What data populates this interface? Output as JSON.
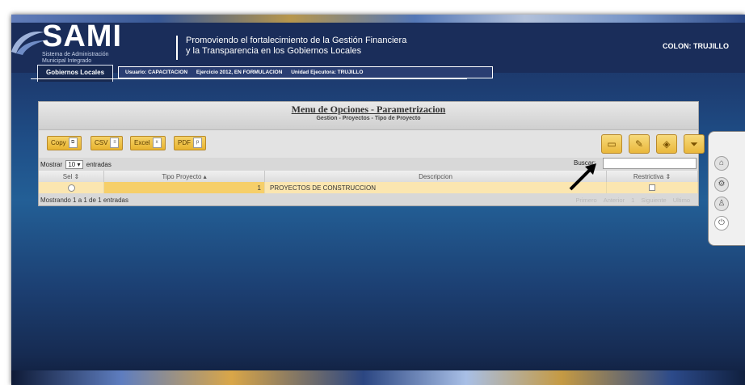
{
  "header": {
    "logo": "SAMI",
    "logo_sub_1": "Sistema de Administración",
    "logo_sub_2": "Municipal Integrado",
    "slogan_line1": "Promoviendo el fortalecimiento de la Gestión Financiera",
    "slogan_line2": "y la Transparencia en los Gobiernos Locales",
    "location": "COLON: TRUJILLO"
  },
  "tabs": {
    "active": "Gobiernos Locales",
    "user": "Usuario: CAPACITACION",
    "exercise": "Ejercicio 2012, EN FORMULACION",
    "unit": "Unidad Ejecutora: TRUJILLO"
  },
  "panel": {
    "title": "Menu de Opciones - Parametrizacion",
    "subtitle": "Gestion - Proyectos - Tipo de Proyecto",
    "export_buttons": [
      "Copy",
      "CSV",
      "Excel",
      "PDF"
    ],
    "show_label": "Mostrar",
    "entries_value": "10",
    "entries_label": "entradas",
    "search_label": "Buscar:",
    "search_value": "",
    "columns": [
      "Sel",
      "Tipo Proyecto",
      "Descripcion",
      "Restrictiva"
    ],
    "rows": [
      {
        "tipo": "1",
        "descripcion": "PROYECTOS DE CONSTRUCCION"
      }
    ],
    "info": "Mostrando 1 a 1 de 1 entradas",
    "pagination": [
      "Primero",
      "Anterior",
      "1",
      "Siguiente",
      "Ultimo"
    ]
  },
  "colors": {
    "background": "#1d3d72",
    "button": "#e8b32e",
    "row_highlight": "#f6cf69"
  }
}
